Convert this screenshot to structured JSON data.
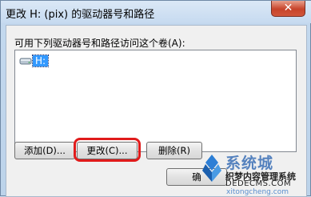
{
  "window": {
    "title": "更改 H: (pix) 的驱动器号和路径",
    "close_glyph": "✕"
  },
  "dialog": {
    "label": "可用下列驱动器号和路径访问这个卷(A):",
    "list_items": [
      {
        "label": "H:",
        "icon": "drive-icon"
      }
    ]
  },
  "buttons": {
    "add": "添加(D)...",
    "change": "更改(C)...",
    "delete": "删除(R)",
    "ok": "确"
  },
  "highlight_color": "#e01b1b",
  "watermark": {
    "title": "系统城",
    "subtitle": "织梦内容管理系统",
    "url1": "DEDECMS.COM",
    "url2": "xitongcheng.com"
  }
}
